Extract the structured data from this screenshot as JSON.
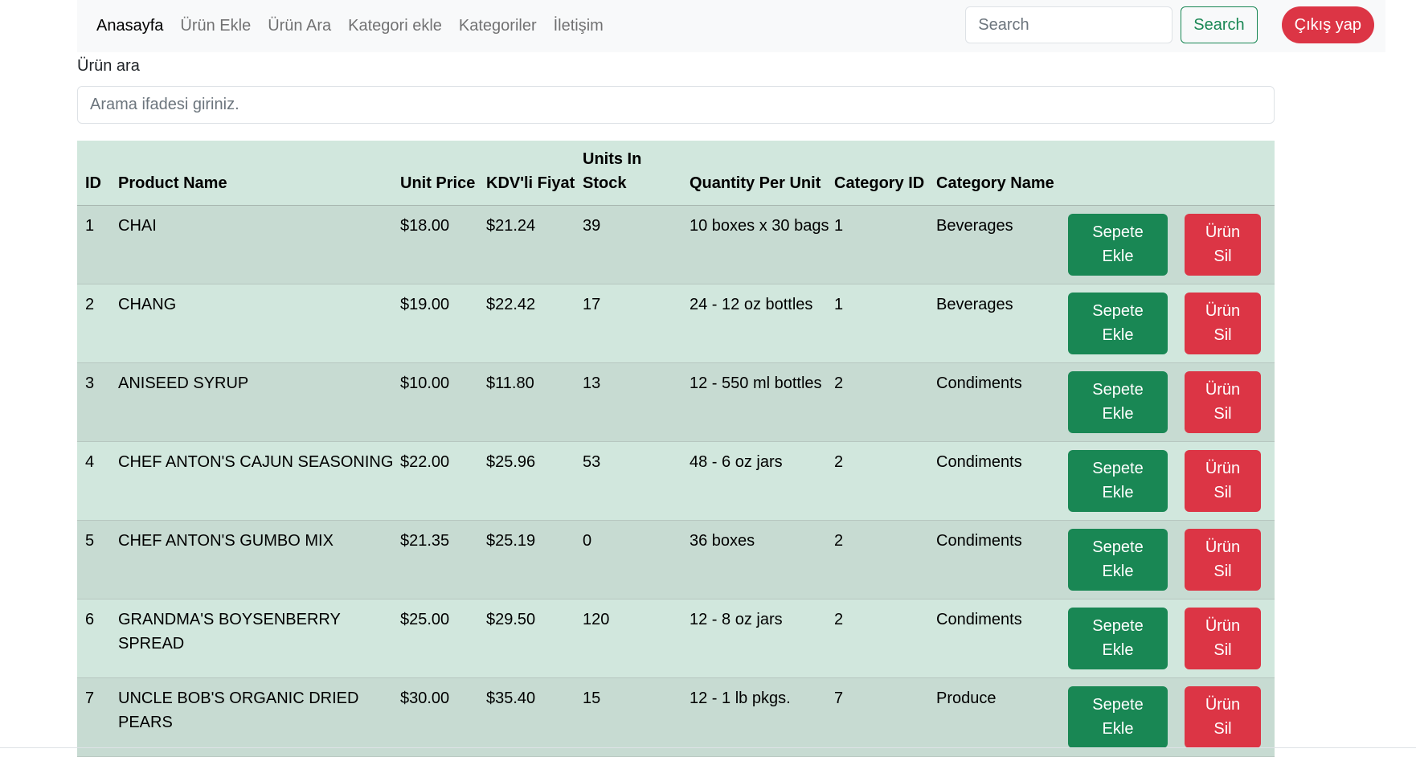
{
  "nav": {
    "links": [
      "Anasayfa",
      "Ürün Ekle",
      "Ürün Ara",
      "Kategori ekle",
      "Kategoriler",
      "İletişim"
    ],
    "search_placeholder": "Search",
    "search_button": "Search",
    "logout_button": "Çıkış yap"
  },
  "search": {
    "label": "Ürün ara",
    "placeholder": "Arama ifadesi giriniz."
  },
  "table": {
    "headers": {
      "id": "ID",
      "product_name": "Product Name",
      "unit_price": "Unit Price",
      "kdv_price": "KDV'li Fiyat",
      "units_in_stock": "Units In Stock",
      "quantity_per_unit": "Quantity Per Unit",
      "category_id": "Category ID",
      "category_name": "Category Name"
    },
    "add_button": {
      "line1": "Sepete",
      "line2": "Ekle"
    },
    "delete_button": {
      "line1": "Ürün",
      "line2": "Sil"
    },
    "rows": [
      {
        "id": "1",
        "name": "CHAI",
        "price": "$18.00",
        "kdv": "$21.24",
        "stock": "39",
        "qty": "10 boxes x 30 bags",
        "cat_id": "1",
        "cat_name": "Beverages"
      },
      {
        "id": "2",
        "name": "CHANG",
        "price": "$19.00",
        "kdv": "$22.42",
        "stock": "17",
        "qty": "24 - 12 oz bottles",
        "cat_id": "1",
        "cat_name": "Beverages"
      },
      {
        "id": "3",
        "name": "ANISEED SYRUP",
        "price": "$10.00",
        "kdv": "$11.80",
        "stock": "13",
        "qty": "12 - 550 ml bottles",
        "cat_id": "2",
        "cat_name": "Condiments"
      },
      {
        "id": "4",
        "name": "CHEF ANTON'S CAJUN SEASONING",
        "price": "$22.00",
        "kdv": "$25.96",
        "stock": "53",
        "qty": "48 - 6 oz jars",
        "cat_id": "2",
        "cat_name": "Condiments"
      },
      {
        "id": "5",
        "name": "CHEF ANTON'S GUMBO MIX",
        "price": "$21.35",
        "kdv": "$25.19",
        "stock": "0",
        "qty": "36 boxes",
        "cat_id": "2",
        "cat_name": "Condiments"
      },
      {
        "id": "6",
        "name": "GRANDMA'S BOYSENBERRY SPREAD",
        "price": "$25.00",
        "kdv": "$29.50",
        "stock": "120",
        "qty": "12 - 8 oz jars",
        "cat_id": "2",
        "cat_name": "Condiments"
      },
      {
        "id": "7",
        "name": "UNCLE BOB'S ORGANIC DRIED PEARS",
        "price": "$30.00",
        "kdv": "$35.40",
        "stock": "15",
        "qty": "12 - 1 lb pkgs.",
        "cat_id": "7",
        "cat_name": "Produce"
      }
    ]
  },
  "colors": {
    "success": "#198754",
    "danger": "#dc3545",
    "table_row": "#d1e7dd",
    "table_row_striped": "#c7dbd2",
    "navbar_bg": "#f8f9fa"
  }
}
